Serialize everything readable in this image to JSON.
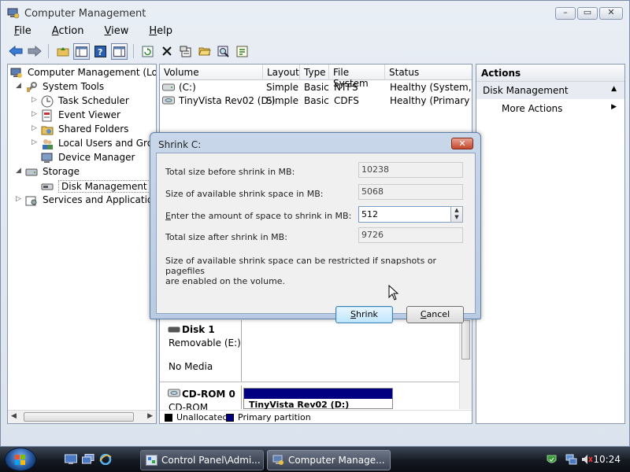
{
  "window": {
    "title": "Computer Management",
    "menu": [
      "File",
      "Action",
      "View",
      "Help"
    ],
    "menu_hotkeys": [
      "F",
      "A",
      "V",
      "H"
    ]
  },
  "tree": {
    "root": "Computer Management (Local",
    "system_tools": "System Tools",
    "task_scheduler": "Task Scheduler",
    "event_viewer": "Event Viewer",
    "shared_folders": "Shared Folders",
    "local_users": "Local Users and Groups",
    "device_manager": "Device Manager",
    "storage": "Storage",
    "disk_management": "Disk Management",
    "services_apps": "Services and Applications"
  },
  "volumes": {
    "columns": [
      "Volume",
      "Layout",
      "Type",
      "File System",
      "Status"
    ],
    "rows": [
      {
        "volume": "(C:)",
        "layout": "Simple",
        "type": "Basic",
        "fs": "NTFS",
        "status": "Healthy (System, Bo"
      },
      {
        "volume": "TinyVista Rev02 (D:)",
        "layout": "Simple",
        "type": "Basic",
        "fs": "CDFS",
        "status": "Healthy (Primary Pa"
      }
    ]
  },
  "disks": {
    "disk1_name": "Disk 1",
    "disk1_type": "Removable (E:)",
    "disk1_media": "No Media",
    "cdrom_name": "CD-ROM 0",
    "cdrom_type": "CD-ROM",
    "cdrom_partition_label": "TinyVista Rev02 (D:)"
  },
  "legend": {
    "unallocated": "Unallocated",
    "primary": "Primary partition",
    "unallocated_color": "#000000",
    "primary_color": "#000080"
  },
  "actions": {
    "header": "Actions",
    "section": "Disk Management",
    "more": "More Actions"
  },
  "dialog": {
    "title": "Shrink C:",
    "total_before_label": "Total size before shrink in MB:",
    "total_before_value": "10238",
    "available_label": "Size of available shrink space in MB:",
    "available_value": "5068",
    "amount_label_pre": "E",
    "amount_label_post": "nter the amount of space to shrink in MB:",
    "amount_value": "512",
    "total_after_label": "Total size after shrink in MB:",
    "total_after_value": "9726",
    "note_line1": "Size of available shrink space can be restricted if snapshots or pagefiles",
    "note_line2": "are enabled on the volume.",
    "shrink_pre": "S",
    "shrink_post": "hrink",
    "cancel_pre": "C",
    "cancel_post": "ancel"
  },
  "taskbar": {
    "btn1": "Control Panel\\Admi...",
    "btn2": "Computer Manage...",
    "clock": "10:24"
  },
  "colors": {
    "accent": "#000080",
    "dialog_close": "#c4472c"
  }
}
